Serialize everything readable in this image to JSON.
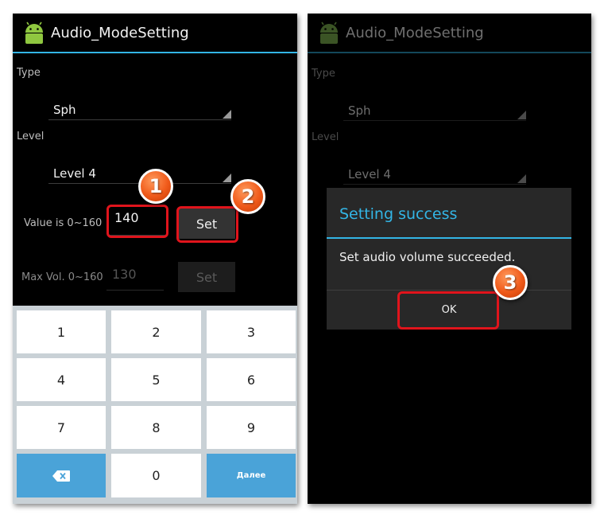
{
  "app": {
    "title": "Audio_ModeSetting"
  },
  "form": {
    "type_label": "Type",
    "type_value": "Sph",
    "level_label": "Level",
    "level_value": "Level 4",
    "value_label": "Value is 0~160",
    "value_input": "140",
    "value_set_label": "Set",
    "maxvol_label": "Max Vol. 0~160",
    "maxvol_input": "130",
    "maxvol_set_label": "Set"
  },
  "keyboard": {
    "keys": [
      "1",
      "2",
      "3",
      "4",
      "5",
      "6",
      "7",
      "8",
      "9",
      "0"
    ],
    "enter_label": "Далее",
    "backspace_icon": "backspace-icon"
  },
  "dialog": {
    "title": "Setting success",
    "message": "Set audio volume succeeded.",
    "ok_label": "OK"
  },
  "steps": [
    "1",
    "2",
    "3"
  ],
  "colors": {
    "accent": "#33b5e5",
    "highlight": "#e0141c",
    "badge": "#f05a1a",
    "key_action": "#4aa3d8"
  }
}
